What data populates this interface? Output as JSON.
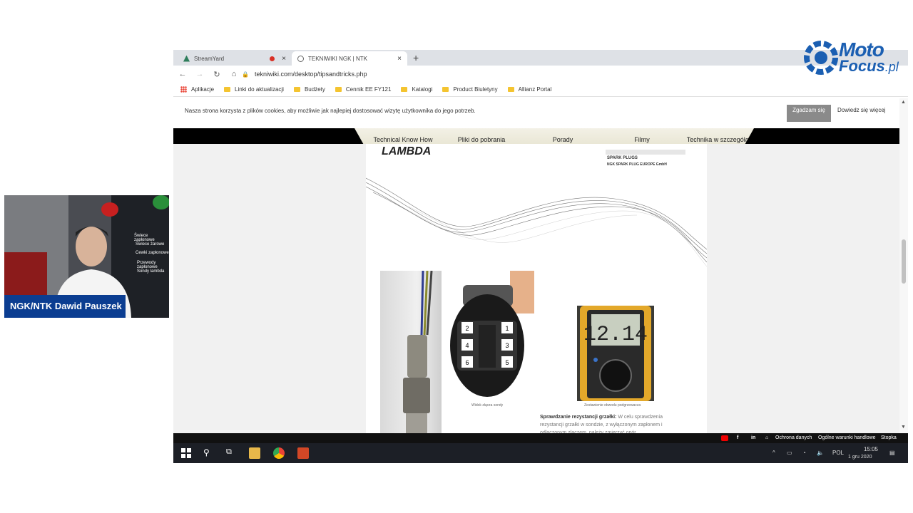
{
  "browser": {
    "tabs": [
      {
        "title": "StreamYard",
        "recording": true
      },
      {
        "title": "TEKNIWIKI NGK | NTK",
        "active": true
      }
    ],
    "url": "tekniwiki.com/desktop/tipsandtricks.php",
    "bookmarks": [
      "Aplikacje",
      "Linki do aktualizacji",
      "Budżety",
      "Cennik EE FY121",
      "Katalogi",
      "Product Biuletyny",
      "Allianz Portal"
    ]
  },
  "cookie_bar": {
    "message": "Nasza strona korzysta z plików cookies, aby możliwie jak najlepiej dostosować wizytę użytkownika do jego potrzeb.",
    "accept_label": "Zgadzam się",
    "more_label": "Dowiedz się więcej"
  },
  "site_nav": {
    "items": [
      "Technical Know How",
      "Pliki do pobrania",
      "Porady",
      "Filmy",
      "Technika w szczegółach"
    ]
  },
  "document": {
    "heading": "LAMBDA",
    "logo_line1": "SPARK PLUGS",
    "logo_line2": "NGK SPARK PLUG EUROPE GmbH",
    "connector_caption": "Widok złącza sondy",
    "meter_reading": "12.14",
    "meter_caption": "Zestawienie obwodu podgrzewacza",
    "paragraph_lead": "Sprawdzanie rezystancji grzałki:",
    "paragraph_text": "W celu sprawdzenia rezystancji grzałki w sondzie, z wyłączonym zapłonem i odłączonym złączem, należy zmierzyć opór..."
  },
  "footer": {
    "links": [
      "Ochrona danych",
      "Ogólne warunki handlowe",
      "Stopka"
    ]
  },
  "taskbar": {
    "language": "POL",
    "time": "15:05",
    "date": "1 gru 2020"
  },
  "brand": {
    "line1": "Moto",
    "line2": "Focus",
    "suffix": ".pl",
    "color": "#1b5fb2"
  },
  "webcam": {
    "presenter": "NGK/NTK Dawid Pauszek",
    "banner_items": [
      "Świece zapłonowe",
      "Świece żarowe",
      "Cewki zapłonowe",
      "Przewody zapłonowe",
      "Sondy lambda"
    ]
  }
}
